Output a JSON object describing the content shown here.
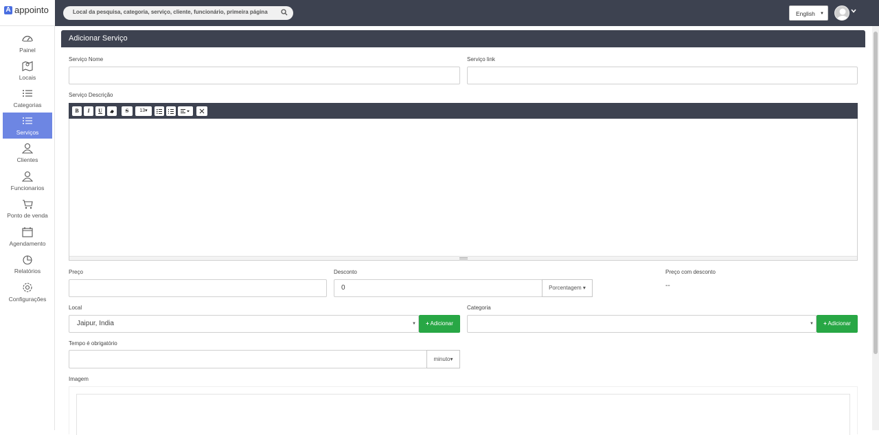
{
  "app": {
    "logo_letter": "A",
    "name": "appointo"
  },
  "search": {
    "placeholder": "Local da pesquisa, categoria, serviço, cliente, funcionário, primeira página"
  },
  "header": {
    "language": "English"
  },
  "sidebar": {
    "items": [
      {
        "label": "Painel",
        "icon": "dashboard-icon"
      },
      {
        "label": "Locais",
        "icon": "map-icon"
      },
      {
        "label": "Categorias",
        "icon": "list-icon"
      },
      {
        "label": "Serviços",
        "icon": "list-icon",
        "active": true
      },
      {
        "label": "Clientes",
        "icon": "user-icon"
      },
      {
        "label": "Funcionarios",
        "icon": "user-icon"
      },
      {
        "label": "Ponto de venda",
        "icon": "cart-icon"
      },
      {
        "label": "Agendamento",
        "icon": "calendar-icon"
      },
      {
        "label": "Relatórios",
        "icon": "pie-chart-icon"
      },
      {
        "label": "Configurações",
        "icon": "gear-icon"
      }
    ]
  },
  "form": {
    "title": "Adicionar Serviço",
    "service_name_label": "Serviço Nome",
    "service_link_label": "Serviço link",
    "description_label": "Serviço Descrição",
    "toolbar": {
      "bold": "B",
      "italic": "I",
      "underline": "U",
      "strike": "S",
      "font_size": "13"
    },
    "price_label": "Preço",
    "discount_label": "Desconto",
    "discount_value": "0",
    "discount_type": "Porcentagem",
    "discounted_price_label": "Preço com desconto",
    "discounted_price_value": "--",
    "location_label": "Local",
    "location_value": "Jaipur, India",
    "add_label": "Adicionar",
    "category_label": "Categoria",
    "time_label": "Tempo é obrigatório",
    "time_unit": "minuto",
    "image_label": "Imagem"
  },
  "colors": {
    "topbar": "#3d4250",
    "active_nav": "#6d86e3",
    "add_button": "#28a745"
  }
}
